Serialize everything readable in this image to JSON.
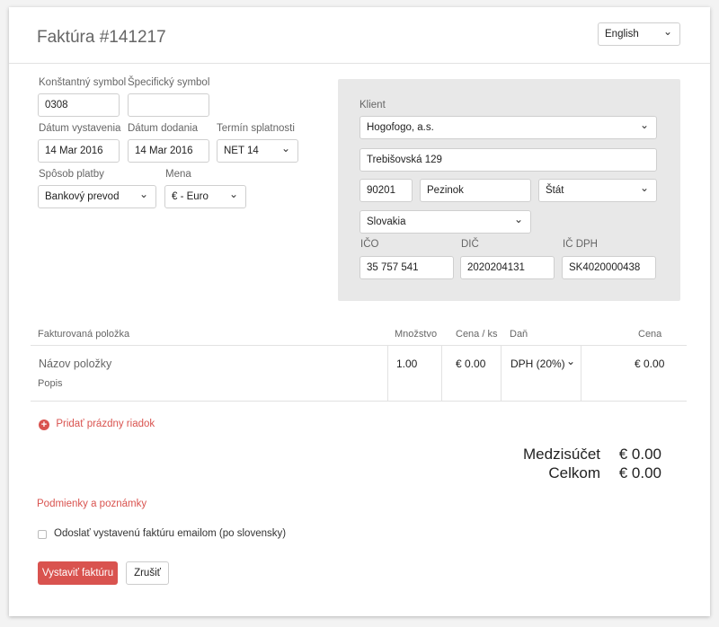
{
  "header": {
    "title": "Faktúra #141217",
    "language_select": "English"
  },
  "form": {
    "constant_symbol": {
      "label": "Konštantný symbol",
      "value": "0308"
    },
    "specific_symbol": {
      "label": "Špecifický symbol",
      "value": ""
    },
    "issue_date": {
      "label": "Dátum vystavenia",
      "value": "14 Mar 2016"
    },
    "delivery_date": {
      "label": "Dátum dodania",
      "value": "14 Mar 2016"
    },
    "due_term": {
      "label": "Termín splatnosti",
      "value": "NET 14"
    },
    "payment_method": {
      "label": "Spôsob platby",
      "value": "Bankový prevod"
    },
    "currency": {
      "label": "Mena",
      "value": "€ - Euro"
    }
  },
  "client": {
    "label": "Klient",
    "name": "Hogofogo, a.s.",
    "street": "Trebišovská 129",
    "zip": "90201",
    "city": "Pezinok",
    "state_placeholder": "Štát",
    "country": "Slovakia",
    "ico": {
      "label": "IČO",
      "value": "35 757 541"
    },
    "dic": {
      "label": "DIČ",
      "value": "2020204131"
    },
    "ic_dph": {
      "label": "IČ DPH",
      "value": "SK4020000438"
    }
  },
  "items_table": {
    "columns": [
      "Fakturovaná položka",
      "Množstvo",
      "Cena / ks",
      "Daň",
      "Cena"
    ],
    "row": {
      "name_placeholder": "Názov položky",
      "description_placeholder": "Popis",
      "quantity": "1.00",
      "unit_price": "€ 0.00",
      "tax": "DPH (20%)",
      "price": "€ 0.00"
    },
    "add_row_label": "Pridať prázdny riadok"
  },
  "totals": {
    "subtotal_label": "Medzisúčet",
    "subtotal_value": "€ 0.00",
    "total_label": "Celkom",
    "total_value": "€ 0.00"
  },
  "notes_link": "Podmienky a poznámky",
  "send_email_checkbox": {
    "label": "Odoslať vystavenú faktúru emailom (po slovensky)",
    "checked": false
  },
  "actions": {
    "submit_label": "Vystaviť faktúru",
    "cancel_label": "Zrušiť"
  },
  "colors": {
    "accent": "#d9534f",
    "panel_bg": "#e8e8e8"
  },
  "icons": {
    "add_row": "plus-circle-icon",
    "select": "chevron-down-icon"
  }
}
